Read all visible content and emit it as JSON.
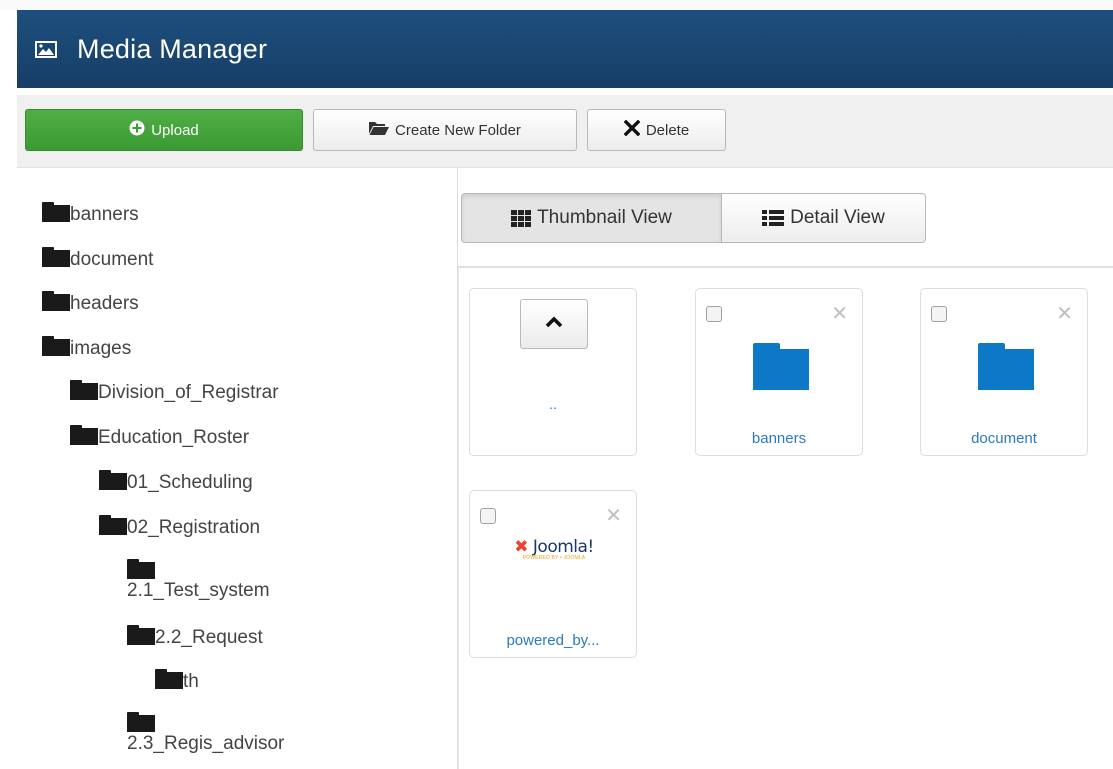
{
  "header": {
    "title": "Media Manager",
    "icon": "image-icon"
  },
  "toolbar": {
    "upload_label": "Upload",
    "create_folder_label": "Create New Folder",
    "delete_label": "Delete"
  },
  "tree": {
    "items": [
      {
        "label": "banners"
      },
      {
        "label": "document"
      },
      {
        "label": "headers"
      },
      {
        "label": "images"
      },
      {
        "label": "Division_of_Registrar"
      },
      {
        "label": "Education_Roster"
      },
      {
        "label": "01_Scheduling"
      },
      {
        "label": "02_Registration"
      },
      {
        "label": "2.1_Test_system"
      },
      {
        "label": "2.2_Request"
      },
      {
        "label": "th"
      },
      {
        "label": "2.3_Regis_advisor"
      }
    ]
  },
  "view": {
    "thumbnail_label": "Thumbnail View",
    "detail_label": "Detail View",
    "active": "thumbnail"
  },
  "files": {
    "up_label": "..",
    "items": [
      {
        "label": "banners",
        "type": "folder"
      },
      {
        "label": "document",
        "type": "folder"
      },
      {
        "label": "powered_by...",
        "type": "image",
        "logo_text": "Joomla!",
        "logo_sub": "POWERED BY • JOOMLA"
      }
    ]
  },
  "colors": {
    "header_bg": "#1b4674",
    "upload_green": "#46a43c",
    "folder_blue": "#0d78c5",
    "link_blue": "#2a7ac0"
  }
}
